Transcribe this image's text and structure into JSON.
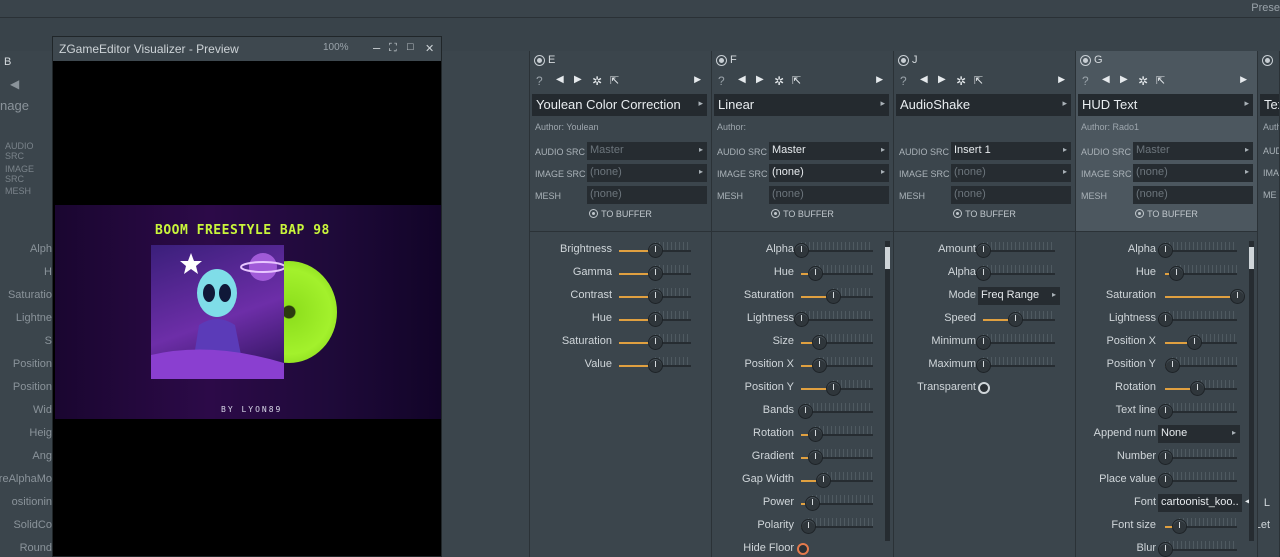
{
  "app": {
    "preset_label": "Prese"
  },
  "window": {
    "title": "ZGameEditor Visualizer - Preview",
    "zoom": "100%",
    "btn_min": "–",
    "btn_fit": "⛶",
    "btn_max": "□",
    "btn_close": "✕"
  },
  "artwork": {
    "title": "BOOM FREESTYLE BAP 98",
    "byline": "BY LYON89"
  },
  "col_b": {
    "letter": "B",
    "name": "nage",
    "labels": [
      "AUDIO SRC",
      "IMAGE SRC",
      "MESH"
    ],
    "params": [
      "Alph",
      "H",
      "Saturatio",
      "Lightne",
      "S",
      "Position",
      "Position",
      "Wid",
      "Heig",
      "Ang",
      "reAlphaMo",
      "ositionin",
      "SolidCo",
      "Round"
    ]
  },
  "labels": {
    "audio_src": "AUDIO SRC",
    "image_src": "IMAGE SRC",
    "mesh": "MESH",
    "to_buffer": "TO BUFFER",
    "help": "?",
    "prev": "◀",
    "next": "▶",
    "more": "▸"
  },
  "columns": [
    {
      "letter": "E",
      "name": "Youlean Color Correction",
      "author": "Author: Youlean",
      "audio": "Master",
      "audio_dim": true,
      "image": "(none)",
      "image_dim": true,
      "mesh": "(none)",
      "params": [
        {
          "label": "Brightness",
          "value": 0.5
        },
        {
          "label": "Gamma",
          "value": 0.5
        },
        {
          "label": "Contrast",
          "value": 0.5
        },
        {
          "label": "Hue",
          "value": 0.5
        },
        {
          "label": "Saturation",
          "value": 0.5
        },
        {
          "label": "Value",
          "value": 0.5
        }
      ]
    },
    {
      "letter": "F",
      "name": "Linear",
      "author": "Author:",
      "audio": "Master",
      "audio_dim": false,
      "image": "(none)",
      "image_dim": false,
      "mesh": "(none)",
      "params": [
        {
          "label": "Alpha",
          "value": 0.0
        },
        {
          "label": "Hue",
          "value": 0.2
        },
        {
          "label": "Saturation",
          "value": 0.45
        },
        {
          "label": "Lightness",
          "value": 0.0
        },
        {
          "label": "Size",
          "value": 0.25
        },
        {
          "label": "Position X",
          "value": 0.25
        },
        {
          "label": "Position Y",
          "value": 0.45
        },
        {
          "label": "Bands",
          "value": 0.05
        },
        {
          "label": "Rotation",
          "value": 0.2
        },
        {
          "label": "Gradient",
          "value": 0.2
        },
        {
          "label": "Gap Width",
          "value": 0.3
        },
        {
          "label": "Power",
          "value": 0.15
        },
        {
          "label": "Polarity",
          "value": 0.1
        },
        {
          "label": "Hide Floor",
          "value": 0
        }
      ]
    },
    {
      "letter": "J",
      "name": "AudioShake",
      "author": "",
      "audio": "Insert 1",
      "audio_dim": false,
      "image": "(none)",
      "image_dim": true,
      "mesh": "(none)",
      "params": [
        {
          "label": "Amount",
          "value": 0.0
        },
        {
          "label": "Alpha",
          "value": 0.0
        },
        {
          "label": "Mode",
          "value": "Freq Range"
        },
        {
          "label": "Speed",
          "value": 0.45
        },
        {
          "label": "Minimum",
          "value": 0.0
        },
        {
          "label": "Maximum",
          "value": 0.0
        },
        {
          "label": "Transparent",
          "value": 0
        }
      ]
    },
    {
      "letter": "G",
      "name": "HUD Text",
      "author": "Author: Rado1",
      "audio": "Master",
      "audio_dim": true,
      "image": "(none)",
      "image_dim": true,
      "mesh": "(none)",
      "params": [
        {
          "label": "Alpha",
          "value": 0.0
        },
        {
          "label": "Hue",
          "value": 0.15
        },
        {
          "label": "Saturation",
          "value": 1.0
        },
        {
          "label": "Lightness",
          "value": 0.0
        },
        {
          "label": "Position X",
          "value": 0.4
        },
        {
          "label": "Position Y",
          "value": 0.1
        },
        {
          "label": "Rotation",
          "value": 0.45
        },
        {
          "label": "Text line",
          "value": 0.0
        },
        {
          "label": "Append num",
          "value": "None"
        },
        {
          "label": "Number",
          "value": 0.0
        },
        {
          "label": "Place value",
          "value": 0.0
        },
        {
          "label": "Font",
          "value": "cartoonist_koo.."
        },
        {
          "label": "Font size",
          "value": 0.2
        },
        {
          "label": "Blur",
          "value": 0
        }
      ]
    },
    {
      "letter": "",
      "name": "Tex",
      "author": "Auth",
      "labels": [
        "AUD",
        "IMA",
        "ME"
      ],
      "params": [
        "L",
        "Let"
      ]
    }
  ]
}
